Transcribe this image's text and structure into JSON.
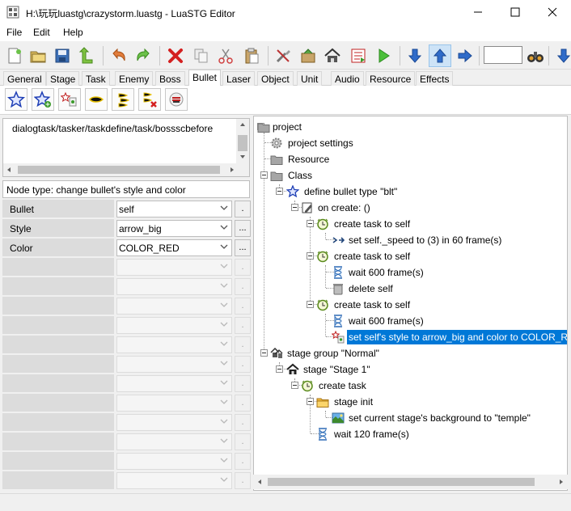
{
  "window": {
    "title": "H:\\玩玩luastg\\crazystorm.luastg - LuaSTG Editor",
    "minimize_glyph": "—",
    "maximize_glyph": "☐",
    "close_glyph": "✕"
  },
  "menu": {
    "items": [
      "File",
      "Edit",
      "Help"
    ]
  },
  "toolbar": {
    "zoom_value": ""
  },
  "tabs": [
    {
      "label": "General"
    },
    {
      "label": "Stage"
    },
    {
      "label": "Task"
    },
    {
      "label": "Enemy"
    },
    {
      "label": "Boss"
    },
    {
      "label": "Bullet",
      "active": true
    },
    {
      "label": "Laser"
    },
    {
      "label": "Object"
    },
    {
      "label": "Unit"
    },
    {
      "label": "Audio"
    },
    {
      "label": "Resource"
    },
    {
      "label": "Effects"
    }
  ],
  "left": {
    "path": "dialogtask/tasker/taskdefine/task/bossscbefore",
    "node_type": "Node type: change bullet's style and color",
    "properties": [
      {
        "label": "Bullet",
        "value": "self",
        "button": "."
      },
      {
        "label": "Style",
        "value": "arrow_big",
        "button": "..."
      },
      {
        "label": "Color",
        "value": "COLOR_RED",
        "button": "..."
      }
    ],
    "empty_button": "."
  },
  "tree": {
    "project": "project",
    "project_settings": "project settings",
    "resource": "Resource",
    "class": "Class",
    "define_bullet": "define bullet type \"blt\"",
    "on_create": "on create: ()",
    "task1": "create task to self",
    "set_speed": "set self._speed to (3) in 60 frame(s)",
    "task2": "create task to self",
    "wait600a": "wait 600 frame(s)",
    "delete_self": "delete self",
    "task3": "create task to self",
    "wait600b": "wait 600 frame(s)",
    "set_style": "set self's style to arrow_big and color to COLOR_RED",
    "stage_group": "stage group \"Normal\"",
    "stage": "stage \"Stage 1\"",
    "create_task": "create task",
    "stage_init": "stage init",
    "set_bg": "set current stage's background to \"temple\"",
    "wait120": "wait 120 frame(s)"
  },
  "colors": {
    "selection": "#0078d7",
    "accent_blue": "#1e6fd9"
  }
}
